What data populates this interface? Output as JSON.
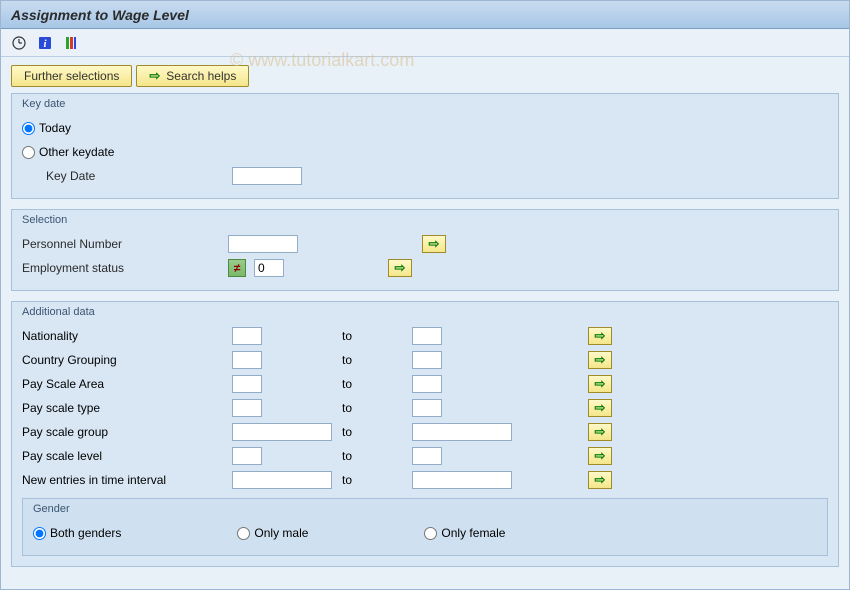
{
  "title": "Assignment to Wage Level",
  "watermark": "© www.tutorialkart.com",
  "buttons": {
    "further_selections": "Further selections",
    "search_helps": "Search helps"
  },
  "groups": {
    "key_date": {
      "legend": "Key date",
      "radio_today": "Today",
      "radio_other": "Other keydate",
      "key_date_label": "Key Date",
      "key_date_value": ""
    },
    "selection": {
      "legend": "Selection",
      "rows": [
        {
          "label": "Personnel Number",
          "value": "",
          "badge": "",
          "input_w": "w70"
        },
        {
          "label": "Employment status",
          "value": "0",
          "badge": "≠",
          "input_w": "w30"
        }
      ]
    },
    "additional": {
      "legend": "Additional data",
      "to_label": "to",
      "rows": [
        {
          "label": "Nationality",
          "from": "",
          "to": "",
          "w": "w30"
        },
        {
          "label": "Country Grouping",
          "from": "",
          "to": "",
          "w": "w30"
        },
        {
          "label": "Pay Scale Area",
          "from": "",
          "to": "",
          "w": "w30"
        },
        {
          "label": "Pay scale type",
          "from": "",
          "to": "",
          "w": "w30"
        },
        {
          "label": "Pay scale group",
          "from": "",
          "to": "",
          "w": "w100"
        },
        {
          "label": "Pay scale level",
          "from": "",
          "to": "",
          "w": "w30"
        },
        {
          "label": "New entries in time interval",
          "from": "",
          "to": "",
          "w": "w100"
        }
      ],
      "gender": {
        "legend": "Gender",
        "options": [
          "Both genders",
          "Only male",
          "Only female"
        ],
        "selected": 0
      }
    }
  }
}
